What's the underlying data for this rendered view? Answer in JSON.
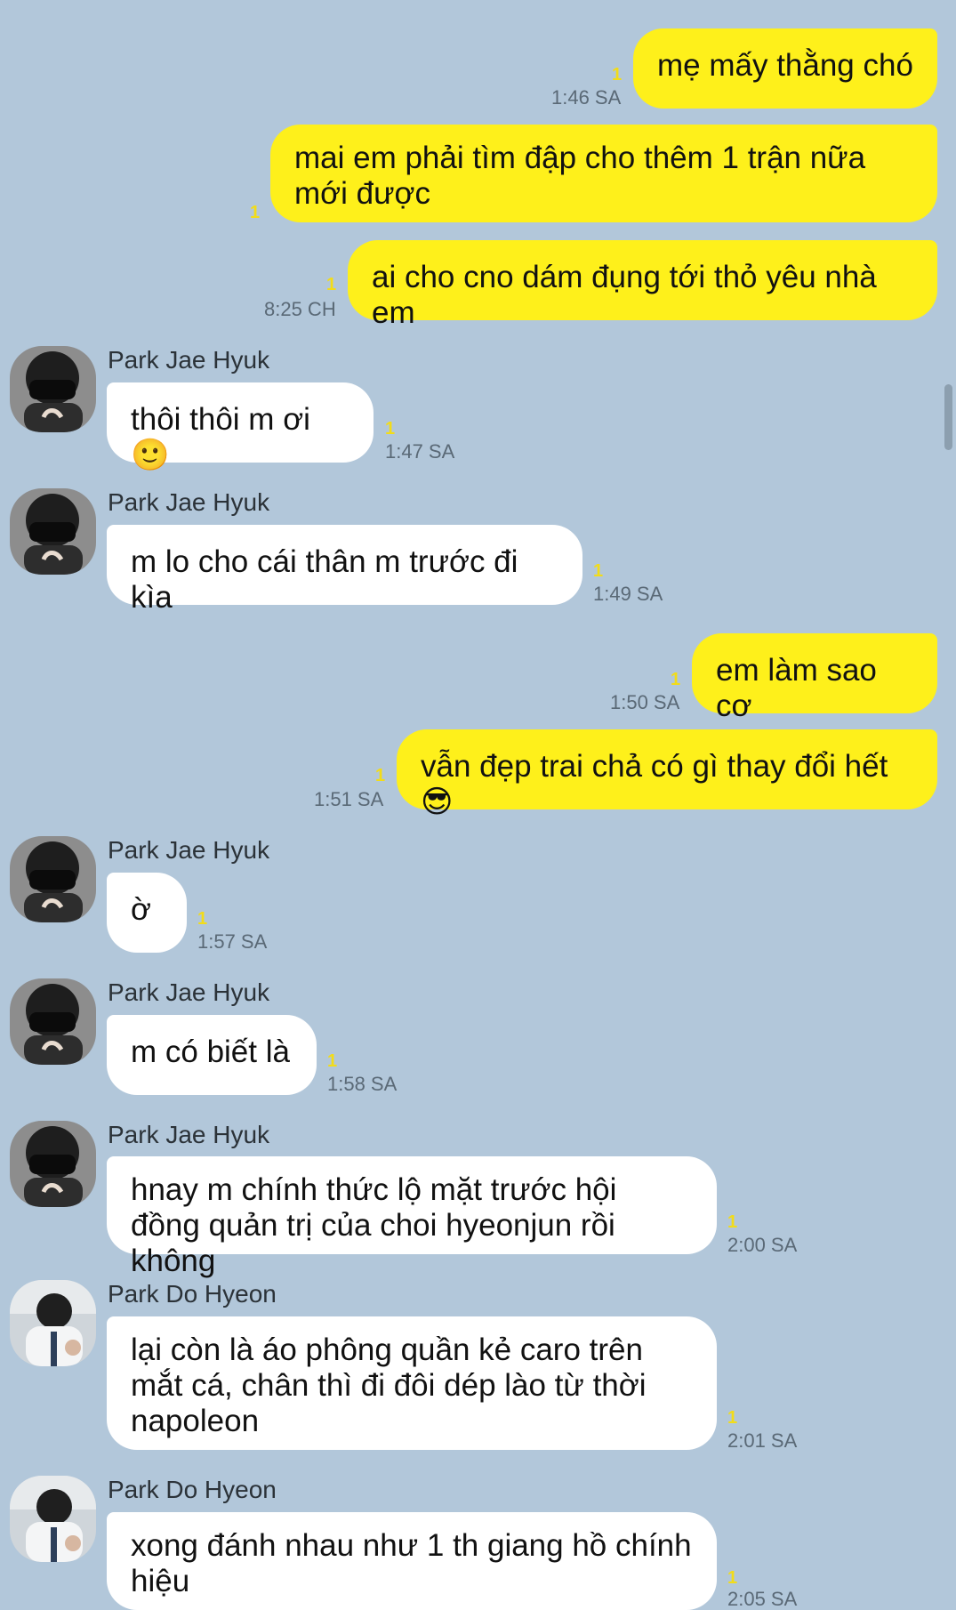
{
  "colors": {
    "background": "#b2c7da",
    "mine_bubble": "#fef01b",
    "their_bubble": "#ffffff",
    "unread_count": "#f2dc19"
  },
  "messages": [
    {
      "side": "mine",
      "text": "mẹ mấy thằng chó",
      "time": "1:46 SA",
      "unread": "1"
    },
    {
      "side": "mine",
      "text": "mai em phải tìm đập cho thêm 1 trận nữa mới được",
      "time": "",
      "unread": "1"
    },
    {
      "side": "mine",
      "text": "ai cho cno dám đụng tới thỏ yêu nhà em",
      "time": "8:25 CH",
      "unread": "1"
    },
    {
      "side": "theirs",
      "sender": "Park Jae Hyuk",
      "avatar_icon": "masked-person-avatar",
      "text": "thôi thôi m ơi 🙂",
      "time": "1:47 SA",
      "unread": "1"
    },
    {
      "side": "theirs",
      "sender": "Park Jae Hyuk",
      "avatar_icon": "masked-person-avatar",
      "text": "m lo cho cái thân m trước đi kìa",
      "time": "1:49 SA",
      "unread": "1"
    },
    {
      "side": "mine",
      "text": "em làm sao cơ",
      "time": "1:50 SA",
      "unread": "1"
    },
    {
      "side": "mine",
      "text": "vẫn đẹp trai chả có gì thay đổi hết 😎",
      "time": "1:51 SA",
      "unread": "1"
    },
    {
      "side": "theirs",
      "sender": "Park Jae Hyuk",
      "avatar_icon": "masked-person-avatar",
      "text": "ờ",
      "time": "1:57 SA",
      "unread": "1"
    },
    {
      "side": "theirs",
      "sender": "Park Jae Hyuk",
      "avatar_icon": "masked-person-avatar",
      "text": "m có biết là",
      "time": "1:58 SA",
      "unread": "1"
    },
    {
      "side": "theirs",
      "sender": "Park Jae Hyuk",
      "avatar_icon": "masked-person-avatar",
      "text": "hnay m chính thức lộ mặt trước hội đồng quản trị của choi hyeonjun rồi không",
      "time": "2:00 SA",
      "unread": "1"
    },
    {
      "side": "theirs",
      "sender": "Park Do Hyeon",
      "avatar_icon": "person-white-shirt-avatar",
      "text": "lại còn là áo phông quần kẻ caro trên mắt cá, chân thì đi đôi dép lào từ thời napoleon",
      "time": "2:01 SA",
      "unread": "1"
    },
    {
      "side": "theirs",
      "sender": "Park Do Hyeon",
      "avatar_icon": "person-white-shirt-avatar",
      "text": "xong đánh nhau như 1 th giang hồ chính hiệu",
      "time": "2:05 SA",
      "unread": "1"
    }
  ]
}
